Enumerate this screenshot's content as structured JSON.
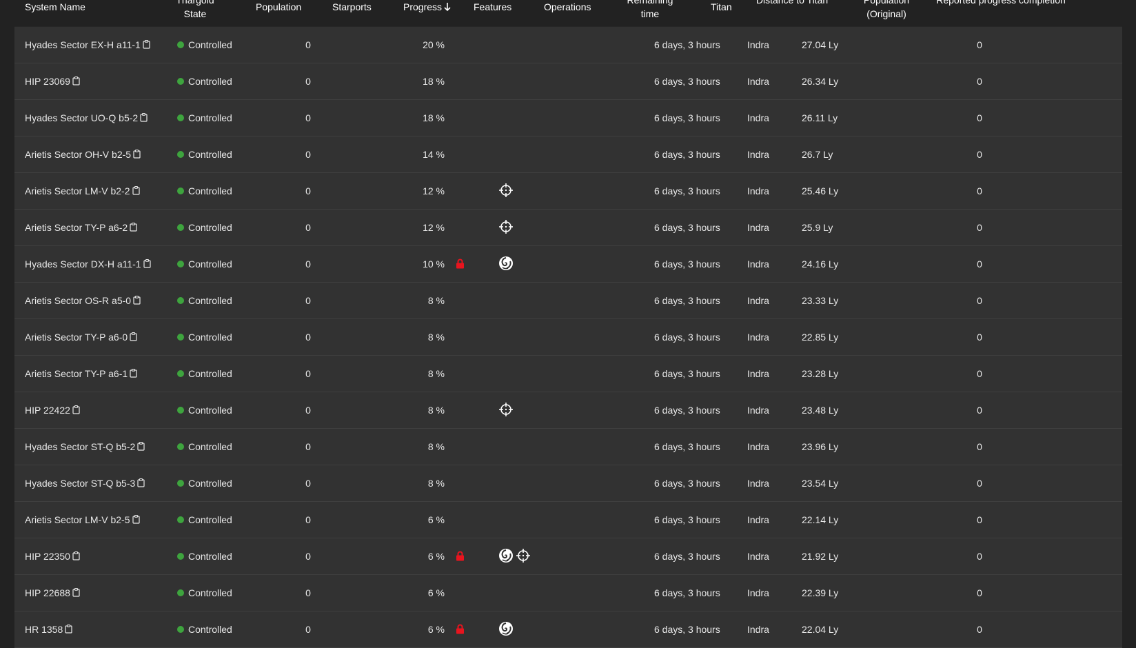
{
  "table": {
    "columns": {
      "system_name": "System Name",
      "thargoid_state": "Thargoid State",
      "population": "Population",
      "starports": "Starports",
      "progress": "Progress",
      "features": "Features",
      "operations": "Operations",
      "remaining_time": "Remaining time",
      "titan": "Titan",
      "distance_to_titan": "Distance to Titan",
      "population_original": "Population (Original)",
      "reported_progress": "Reported progress completion"
    },
    "sort": {
      "column": "progress",
      "direction": "descending",
      "icon": "arrow-down-icon"
    },
    "colors": {
      "state_dot": "#3ea43e",
      "lock": "#e8141e",
      "row_bg": "#323232",
      "page_bg": "#222222"
    },
    "rows": [
      {
        "name": "Hyades Sector EX-H a11-1",
        "state": "Controlled",
        "population": "0",
        "progress": "20 %",
        "locked": false,
        "features": [],
        "remaining": "6 days, 3 hours",
        "titan": "Indra",
        "distance": "27.04 Ly",
        "population_original": "0"
      },
      {
        "name": "HIP 23069",
        "state": "Controlled",
        "population": "0",
        "progress": "18 %",
        "locked": false,
        "features": [],
        "remaining": "6 days, 3 hours",
        "titan": "Indra",
        "distance": "26.34 Ly",
        "population_original": "0"
      },
      {
        "name": "Hyades Sector UO-Q b5-2",
        "state": "Controlled",
        "population": "0",
        "progress": "18 %",
        "locked": false,
        "features": [],
        "remaining": "6 days, 3 hours",
        "titan": "Indra",
        "distance": "26.11 Ly",
        "population_original": "0"
      },
      {
        "name": "Arietis Sector OH-V b2-5",
        "state": "Controlled",
        "population": "0",
        "progress": "14 %",
        "locked": false,
        "features": [],
        "remaining": "6 days, 3 hours",
        "titan": "Indra",
        "distance": "26.7 Ly",
        "population_original": "0"
      },
      {
        "name": "Arietis Sector LM-V b2-2",
        "state": "Controlled",
        "population": "0",
        "progress": "12 %",
        "locked": false,
        "features": [
          "crosshair-icon"
        ],
        "remaining": "6 days, 3 hours",
        "titan": "Indra",
        "distance": "25.46 Ly",
        "population_original": "0"
      },
      {
        "name": "Arietis Sector TY-P a6-2",
        "state": "Controlled",
        "population": "0",
        "progress": "12 %",
        "locked": false,
        "features": [
          "crosshair-icon"
        ],
        "remaining": "6 days, 3 hours",
        "titan": "Indra",
        "distance": "25.9 Ly",
        "population_original": "0"
      },
      {
        "name": "Hyades Sector DX-H a11-1",
        "state": "Controlled",
        "population": "0",
        "progress": "10 %",
        "locked": true,
        "features": [
          "swirl-icon"
        ],
        "remaining": "6 days, 3 hours",
        "titan": "Indra",
        "distance": "24.16 Ly",
        "population_original": "0"
      },
      {
        "name": "Arietis Sector OS-R a5-0",
        "state": "Controlled",
        "population": "0",
        "progress": "8 %",
        "locked": false,
        "features": [],
        "remaining": "6 days, 3 hours",
        "titan": "Indra",
        "distance": "23.33 Ly",
        "population_original": "0"
      },
      {
        "name": "Arietis Sector TY-P a6-0",
        "state": "Controlled",
        "population": "0",
        "progress": "8 %",
        "locked": false,
        "features": [],
        "remaining": "6 days, 3 hours",
        "titan": "Indra",
        "distance": "22.85 Ly",
        "population_original": "0"
      },
      {
        "name": "Arietis Sector TY-P a6-1",
        "state": "Controlled",
        "population": "0",
        "progress": "8 %",
        "locked": false,
        "features": [],
        "remaining": "6 days, 3 hours",
        "titan": "Indra",
        "distance": "23.28 Ly",
        "population_original": "0"
      },
      {
        "name": "HIP 22422",
        "state": "Controlled",
        "population": "0",
        "progress": "8 %",
        "locked": false,
        "features": [
          "crosshair-icon"
        ],
        "remaining": "6 days, 3 hours",
        "titan": "Indra",
        "distance": "23.48 Ly",
        "population_original": "0"
      },
      {
        "name": "Hyades Sector ST-Q b5-2",
        "state": "Controlled",
        "population": "0",
        "progress": "8 %",
        "locked": false,
        "features": [],
        "remaining": "6 days, 3 hours",
        "titan": "Indra",
        "distance": "23.96 Ly",
        "population_original": "0"
      },
      {
        "name": "Hyades Sector ST-Q b5-3",
        "state": "Controlled",
        "population": "0",
        "progress": "8 %",
        "locked": false,
        "features": [],
        "remaining": "6 days, 3 hours",
        "titan": "Indra",
        "distance": "23.54 Ly",
        "population_original": "0"
      },
      {
        "name": "Arietis Sector LM-V b2-5",
        "state": "Controlled",
        "population": "0",
        "progress": "6 %",
        "locked": false,
        "features": [],
        "remaining": "6 days, 3 hours",
        "titan": "Indra",
        "distance": "22.14 Ly",
        "population_original": "0"
      },
      {
        "name": "HIP 22350",
        "state": "Controlled",
        "population": "0",
        "progress": "6 %",
        "locked": true,
        "features": [
          "swirl-icon",
          "crosshair-icon"
        ],
        "remaining": "6 days, 3 hours",
        "titan": "Indra",
        "distance": "21.92 Ly",
        "population_original": "0"
      },
      {
        "name": "HIP 22688",
        "state": "Controlled",
        "population": "0",
        "progress": "6 %",
        "locked": false,
        "features": [],
        "remaining": "6 days, 3 hours",
        "titan": "Indra",
        "distance": "22.39 Ly",
        "population_original": "0"
      },
      {
        "name": "HR 1358",
        "state": "Controlled",
        "population": "0",
        "progress": "6 %",
        "locked": true,
        "features": [
          "swirl-icon"
        ],
        "remaining": "6 days, 3 hours",
        "titan": "Indra",
        "distance": "22.04 Ly",
        "population_original": "0"
      }
    ]
  }
}
